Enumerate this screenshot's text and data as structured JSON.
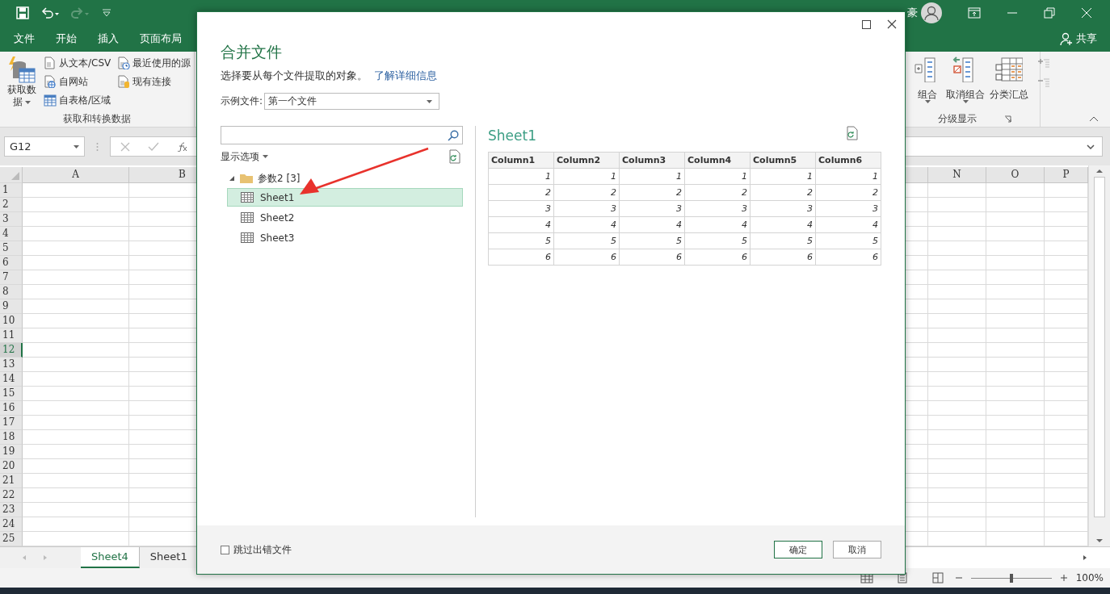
{
  "title_bar": {
    "user": "豪"
  },
  "ribbon_tabs": [
    {
      "label": "文件"
    },
    {
      "label": "开始"
    },
    {
      "label": "插入"
    },
    {
      "label": "页面布局"
    }
  ],
  "share": "共享",
  "ribbon_groups": [
    {
      "label": "获取和转换数据",
      "large_button": {
        "label": "获取数据"
      },
      "buttons": [
        {
          "label": "从文本/CSV",
          "kind": "text"
        },
        {
          "label": "自网站",
          "kind": "web"
        },
        {
          "label": "自表格/区域",
          "kind": "table"
        },
        {
          "label": "最近使用的源",
          "kind": "recent"
        },
        {
          "label": "现有连接",
          "kind": "conn"
        }
      ]
    },
    {
      "label": "分级显示",
      "large_buttons": [
        {
          "label": "组合",
          "kind": "group"
        },
        {
          "label": "取消组合",
          "kind": "ungroup"
        },
        {
          "label": "分类汇总",
          "kind": "subtotal"
        }
      ]
    }
  ],
  "formula_bar": {
    "name_box": "G12"
  },
  "sheet": {
    "columns_left": [
      "A",
      "B"
    ],
    "columns_right": [
      "N",
      "O",
      "P"
    ],
    "rows": [
      {
        "label": "1",
        "selected": false
      },
      {
        "label": "2",
        "selected": false
      },
      {
        "label": "3",
        "selected": false
      },
      {
        "label": "4",
        "selected": false
      },
      {
        "label": "5",
        "selected": false
      },
      {
        "label": "6",
        "selected": false
      },
      {
        "label": "7",
        "selected": false
      },
      {
        "label": "8",
        "selected": false
      },
      {
        "label": "9",
        "selected": false
      },
      {
        "label": "10",
        "selected": false
      },
      {
        "label": "11",
        "selected": false
      },
      {
        "label": "12",
        "selected": true
      },
      {
        "label": "13",
        "selected": false
      },
      {
        "label": "14",
        "selected": false
      },
      {
        "label": "15",
        "selected": false
      },
      {
        "label": "16",
        "selected": false
      },
      {
        "label": "17",
        "selected": false
      },
      {
        "label": "18",
        "selected": false
      },
      {
        "label": "19",
        "selected": false
      },
      {
        "label": "20",
        "selected": false
      },
      {
        "label": "21",
        "selected": false
      },
      {
        "label": "22",
        "selected": false
      },
      {
        "label": "23",
        "selected": false
      },
      {
        "label": "24",
        "selected": false
      },
      {
        "label": "25",
        "selected": false
      }
    ]
  },
  "sheet_tabs": [
    {
      "label": "Sheet4",
      "selected": true
    },
    {
      "label": "Sheet1",
      "selected": false
    }
  ],
  "status_bar": {
    "zoom": "100%",
    "level": 0.5
  },
  "dialog": {
    "title": "合并文件",
    "description": "选择要从每个文件提取的对象。",
    "link": "了解详细信息",
    "sample_label": "示例文件:",
    "sample_value": "第一个文件",
    "options_label": "显示选项",
    "tree": [
      {
        "label": "参数2 [3]",
        "expanded": true,
        "children": [
          {
            "label": "Sheet1",
            "selected": true
          },
          {
            "label": "Sheet2",
            "selected": false
          },
          {
            "label": "Sheet3",
            "selected": false
          }
        ]
      }
    ],
    "preview": {
      "title": "Sheet1",
      "columns": [
        "Column1",
        "Column2",
        "Column3",
        "Column4",
        "Column5",
        "Column6"
      ],
      "rows": [
        [
          "1",
          "1",
          "1",
          "1",
          "1",
          "1"
        ],
        [
          "2",
          "2",
          "2",
          "2",
          "2",
          "2"
        ],
        [
          "3",
          "3",
          "3",
          "3",
          "3",
          "3"
        ],
        [
          "4",
          "4",
          "4",
          "4",
          "4",
          "4"
        ],
        [
          "5",
          "5",
          "5",
          "5",
          "5",
          "5"
        ],
        [
          "6",
          "6",
          "6",
          "6",
          "6",
          "6"
        ]
      ]
    },
    "skip_errors": {
      "label": "跳过出错文件",
      "checked": false
    },
    "buttons": [
      {
        "label": "确定",
        "kind": "primary"
      },
      {
        "label": "取消",
        "kind": "secondary"
      }
    ]
  }
}
